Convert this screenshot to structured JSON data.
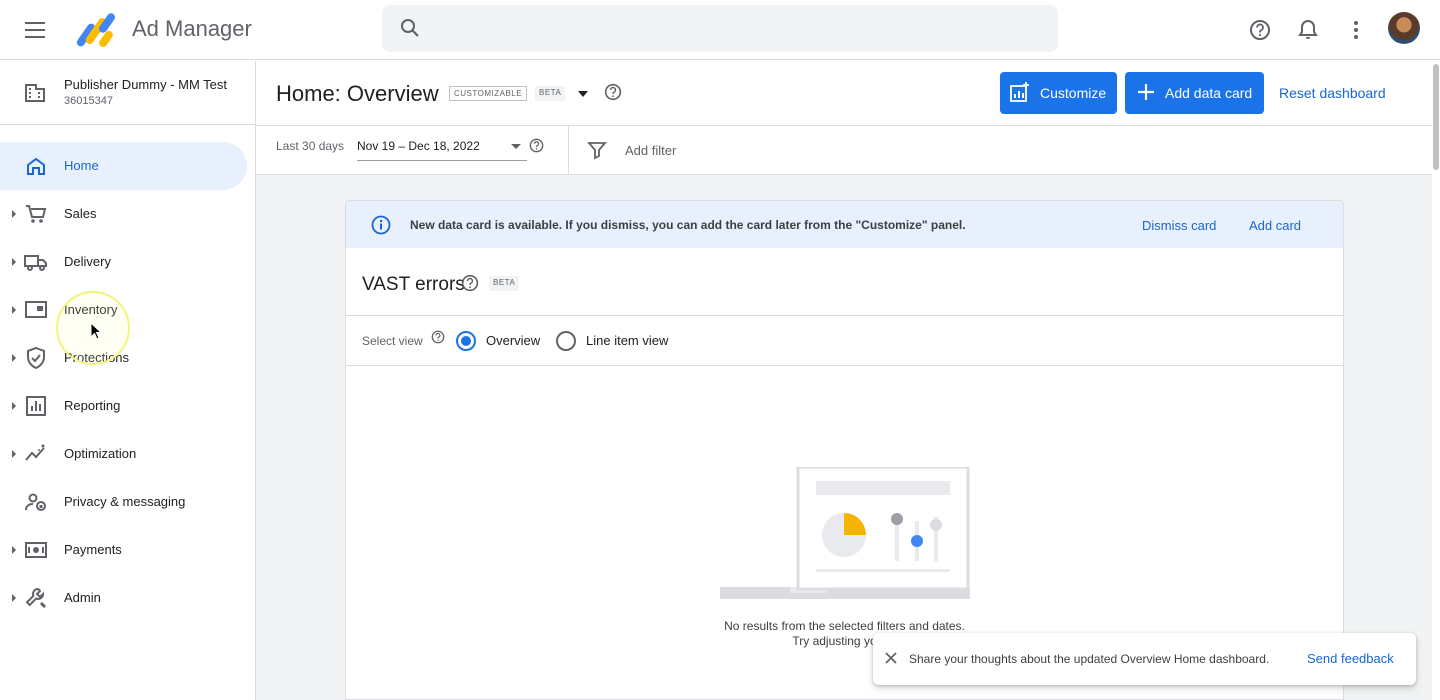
{
  "app": {
    "title": "Ad Manager"
  },
  "search": {
    "placeholder": ""
  },
  "account": {
    "name": "Publisher Dummy - MM Test",
    "id": "36015347"
  },
  "nav": {
    "items": [
      {
        "label": "Home",
        "icon": "home-icon",
        "active": true
      },
      {
        "label": "Sales",
        "icon": "cart-icon"
      },
      {
        "label": "Delivery",
        "icon": "truck-icon"
      },
      {
        "label": "Inventory",
        "icon": "inventory-icon"
      },
      {
        "label": "Protections",
        "icon": "shield-icon"
      },
      {
        "label": "Reporting",
        "icon": "reporting-icon"
      },
      {
        "label": "Optimization",
        "icon": "optimization-icon"
      },
      {
        "label": "Privacy & messaging",
        "icon": "privacy-icon"
      },
      {
        "label": "Payments",
        "icon": "payments-icon"
      },
      {
        "label": "Admin",
        "icon": "wrench-icon"
      }
    ]
  },
  "header": {
    "title": "Home: Overview",
    "tag_customizable": "CUSTOMIZABLE",
    "tag_beta": "BETA",
    "customize_label": "Customize",
    "add_card_label": "Add data card",
    "reset_label": "Reset dashboard"
  },
  "filters": {
    "range_label": "Last 30 days",
    "date_value": "Nov 19 – Dec 18, 2022",
    "add_filter_label": "Add filter"
  },
  "notice": {
    "message": "New data card is available. If you dismiss, you can add the card later from the \"Customize\" panel.",
    "dismiss_label": "Dismiss card",
    "add_label": "Add card"
  },
  "card": {
    "title": "VAST errors",
    "tag": "BETA",
    "select_view_label": "Select view",
    "options": [
      {
        "label": "Overview",
        "checked": true
      },
      {
        "label": "Line item view",
        "checked": false
      }
    ],
    "empty_line1": "No results from the selected filters and dates.",
    "empty_line2": "Try adjusting your s"
  },
  "snackbar": {
    "message": "Share your thoughts about the updated Overview Home dashboard.",
    "action": "Send feedback"
  },
  "colors": {
    "primary": "#1a73e8",
    "link": "#1967d2",
    "active_bg": "#e8f0fe",
    "illus_yellow": "#f4b400",
    "illus_blue": "#4285f4"
  }
}
